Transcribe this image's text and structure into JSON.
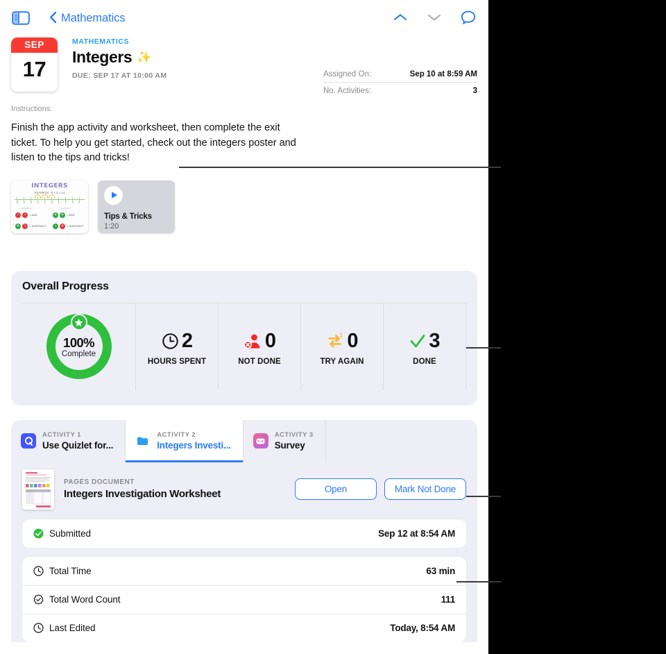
{
  "navbar": {
    "sidebar_toggle_name": "sidebar-toggle-icon",
    "back_label": "Mathematics",
    "icons": [
      "chevron-up-icon",
      "chevron-down-icon",
      "comment-bubble-icon"
    ]
  },
  "assignment": {
    "date_badge": {
      "month": "SEP",
      "day": "17"
    },
    "course": "MATHEMATICS",
    "title": "Integers",
    "title_emoji": "✨",
    "due": "DUE: SEP 17 AT 10:00 AM",
    "meta": [
      {
        "key": "Assigned On:",
        "value": "Sep 10 at 8:59 AM"
      },
      {
        "key": "No. Activities:",
        "value": "3"
      }
    ]
  },
  "instructions": {
    "label": "Instructions:",
    "body": "Finish the app activity and worksheet, then complete the exit ticket. To help you get started, check out the integers poster and listen to the tips and tricks!"
  },
  "attachments": {
    "poster": {
      "name": "integers-poster-thumbnail",
      "heading": "INTEGERS",
      "example": "EXAMPLE: -5 + 4 = ±1",
      "left_label": "negative",
      "right_label": "positive",
      "numbers": [
        "-5",
        "-4",
        "-3",
        "-2",
        "-1",
        "0",
        "1",
        "2",
        "3",
        "4",
        "5"
      ],
      "legend": [
        {
          "chips": [
            "-",
            "-"
          ],
          "text": "= ADD"
        },
        {
          "chips": [
            "+",
            "+"
          ],
          "text": "= ADD"
        },
        {
          "chips": [
            "+",
            "-"
          ],
          "text": "= SUBTRACT"
        },
        {
          "chips": [
            "-",
            "+"
          ],
          "text": "= SUBTRACT"
        }
      ]
    },
    "audio": {
      "icon": "play-icon",
      "title": "Tips & Tricks",
      "duration": "1:20"
    }
  },
  "progress": {
    "title": "Overall Progress",
    "ring": {
      "percent": "100%",
      "label": "Complete",
      "color": "#2fbf3d",
      "badge_icon": "star-icon"
    },
    "stats": [
      {
        "icon": "clock-icon",
        "icon_color": "#111111",
        "value": "2",
        "label": "HOURS SPENT"
      },
      {
        "icon": "person-x-icon",
        "icon_color": "#f02b2b",
        "value": "0",
        "label": "NOT DONE"
      },
      {
        "icon": "loop-retry-icon",
        "icon_color": "#f7b733",
        "value": "0",
        "label": "TRY AGAIN"
      },
      {
        "icon": "checkmark-icon",
        "icon_color": "#2fbf3d",
        "value": "3",
        "label": "DONE"
      }
    ]
  },
  "activities": {
    "tabs": [
      {
        "eyebrow": "ACTIVITY 1",
        "name": "Use Quizlet for...",
        "icon": "quizlet-app-icon",
        "active": false
      },
      {
        "eyebrow": "ACTIVITY 2",
        "name": "Integers Investi...",
        "icon": "files-app-icon",
        "active": true
      },
      {
        "eyebrow": "ACTIVITY 3",
        "name": "Survey",
        "icon": "survey-app-icon",
        "active": false
      }
    ],
    "document": {
      "kind": "PAGES DOCUMENT",
      "name": "Integers Investigation Worksheet",
      "thumbnail_name": "pages-document-thumbnail",
      "open_button": "Open",
      "mark_button": "Mark Not Done"
    },
    "submitted": {
      "icon": "checkmark-circle-icon",
      "label": "Submitted",
      "value": "Sep 12 at 8:54 AM"
    },
    "details": [
      {
        "icon": "clock-icon",
        "label": "Total Time",
        "value": "63 min"
      },
      {
        "icon": "seal-check-icon",
        "label": "Total Word Count",
        "value": "111"
      },
      {
        "icon": "clock-icon",
        "label": "Last Edited",
        "value": "Today, 8:54 AM"
      }
    ]
  },
  "colors": {
    "accent_blue": "#2a7cf7",
    "card_bg": "#eeeef6",
    "green": "#2fbf3d",
    "red": "#f73b33",
    "yellow": "#f7b733"
  }
}
